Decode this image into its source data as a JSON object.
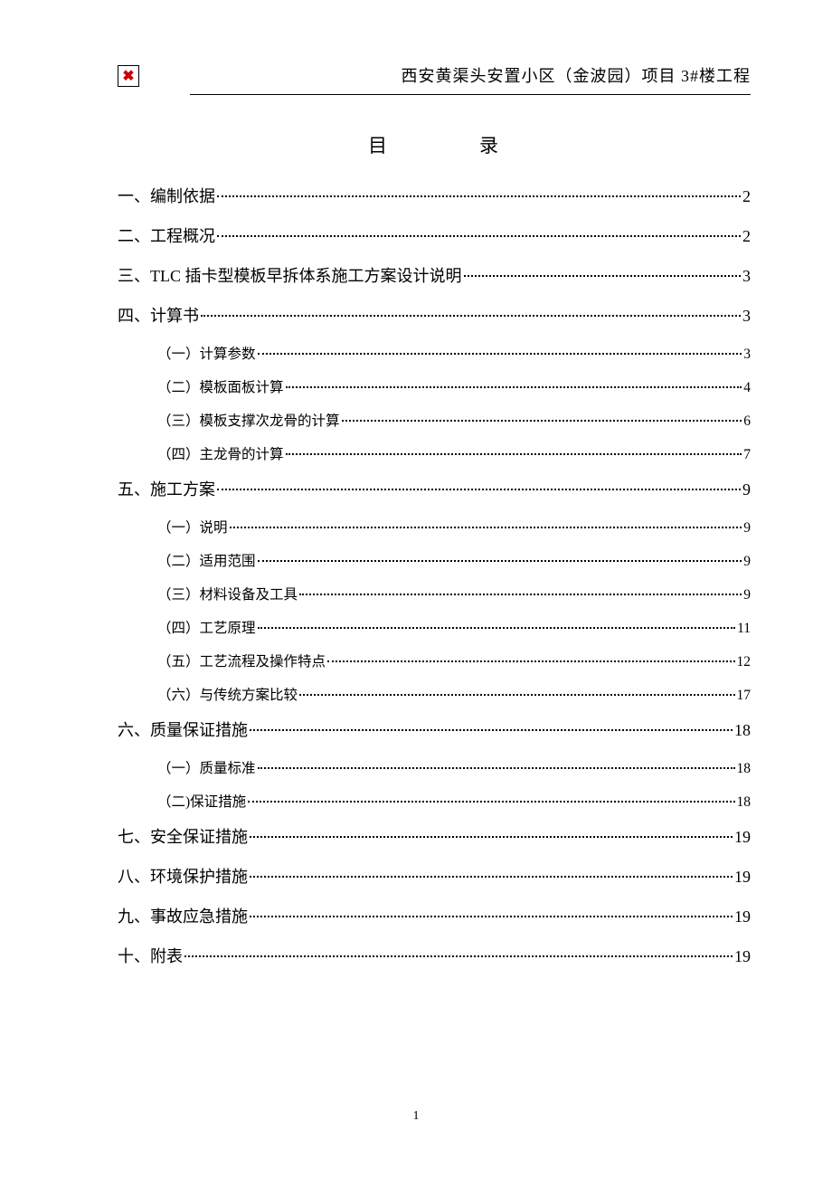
{
  "header": {
    "logo_symbol": "✖",
    "title": "西安黄渠头安置小区（金波园）项目 3#楼工程"
  },
  "toc_title_left": "目",
  "toc_title_right": "录",
  "toc": [
    {
      "level": 1,
      "text": "一、编制依据",
      "page": "2"
    },
    {
      "level": 1,
      "text": "二、工程概况",
      "page": "2"
    },
    {
      "level": 1,
      "text": "三、TLC 插卡型模板早拆体系施工方案设计说明",
      "page": "3"
    },
    {
      "level": 1,
      "text": "四、计算书",
      "page": "3"
    },
    {
      "level": 2,
      "text": "（一）计算参数",
      "page": "3"
    },
    {
      "level": 2,
      "text": "（二）模板面板计算",
      "page": "4"
    },
    {
      "level": 2,
      "text": "（三）模板支撑次龙骨的计算",
      "page": "6"
    },
    {
      "level": 2,
      "text": "（四）主龙骨的计算",
      "page": "7"
    },
    {
      "level": 1,
      "text": "五、施工方案",
      "page": "9"
    },
    {
      "level": 2,
      "text": "（一）说明",
      "page": "9"
    },
    {
      "level": 2,
      "text": "（二）适用范围",
      "page": "9"
    },
    {
      "level": 2,
      "text": "（三）材料设备及工具",
      "page": "9"
    },
    {
      "level": 2,
      "text": "（四）工艺原理",
      "page": "11"
    },
    {
      "level": 2,
      "text": "（五）工艺流程及操作特点",
      "page": "12"
    },
    {
      "level": 2,
      "text": "（六）与传统方案比较",
      "page": "17"
    },
    {
      "level": 1,
      "text": "六、质量保证措施",
      "page": "18"
    },
    {
      "level": 2,
      "text": "（一）质量标准",
      "page": "18"
    },
    {
      "level": 2,
      "text": "（二)保证措施",
      "page": "18"
    },
    {
      "level": 1,
      "text": "七、安全保证措施",
      "page": "19"
    },
    {
      "level": 1,
      "text": "八、环境保护措施",
      "page": "19"
    },
    {
      "level": 1,
      "text": "九、事故应急措施",
      "page": "19"
    },
    {
      "level": 1,
      "text": "十、附表",
      "page": "19"
    }
  ],
  "page_number": "1"
}
